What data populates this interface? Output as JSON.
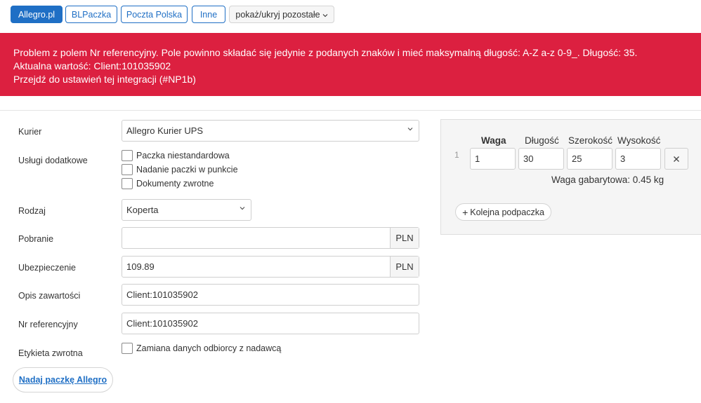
{
  "tabs": [
    {
      "label": "Allegro.pl",
      "active": true
    },
    {
      "label": "BLPaczka",
      "active": false
    },
    {
      "label": "Poczta Polska",
      "active": false
    },
    {
      "label": "Inne",
      "active": false
    }
  ],
  "toggle_more": {
    "label": "pokaż/ukryj pozostałe",
    "icon": "chevron-down-icon"
  },
  "alert": {
    "line1": "Problem z polem Nr referencyjny. Pole powinno składać się jedynie z podanych znaków i mieć maksymalną długość: A-Z a-z 0-9_. Długość: 35.",
    "line2": "Aktualna wartość: Client:101035902",
    "line3": "Przejdź do ustawień tej integracji (#NP1b)",
    "color": "#dc2040"
  },
  "form": {
    "courier": {
      "label": "Kurier",
      "value": "Allegro Kurier UPS"
    },
    "extras": {
      "label": "Usługi dodatkowe",
      "options": [
        {
          "label": "Paczka niestandardowa",
          "checked": false
        },
        {
          "label": "Nadanie paczki w punkcie",
          "checked": false
        },
        {
          "label": "Dokumenty zwrotne",
          "checked": false
        }
      ]
    },
    "type": {
      "label": "Rodzaj",
      "value": "Koperta"
    },
    "cod": {
      "label": "Pobranie",
      "value": "",
      "currency": "PLN"
    },
    "insurance": {
      "label": "Ubezpieczenie",
      "value": "109.89",
      "currency": "PLN"
    },
    "contents": {
      "label": "Opis zawartości",
      "value": "Client:101035902"
    },
    "reference": {
      "label": "Nr referencyjny",
      "value": "Client:101035902"
    },
    "return_label": {
      "label": "Etykieta zwrotna",
      "option": "Zamiana danych odbiorcy z nadawcą",
      "checked": false
    },
    "submit": {
      "label": "Nadaj paczkę Allegro"
    }
  },
  "packages": {
    "headers": {
      "weight": "Waga",
      "length": "Długość",
      "width": "Szerokość",
      "height": "Wysokość"
    },
    "rows": [
      {
        "num": "1",
        "weight": "1",
        "length": "30",
        "width": "25",
        "height": "3"
      }
    ],
    "dim_weight": "Waga gabarytowa: 0.45 kg",
    "add_label": "Kolejna podpaczka"
  },
  "colors": {
    "accent": "#1f6fc5",
    "alert": "#dc2040"
  }
}
